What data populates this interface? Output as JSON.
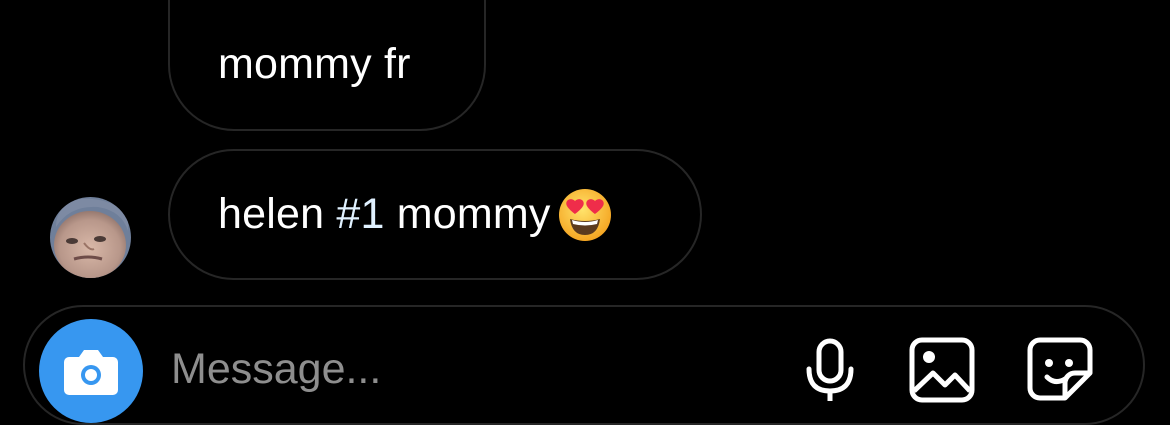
{
  "messages": [
    {
      "text": "mommy fr"
    },
    {
      "text_before": "helen ",
      "hashtag": "#1",
      "text_after": " mommy",
      "emoji": "heart-eyes-emoji"
    }
  ],
  "composer": {
    "placeholder": "Message...",
    "icons": [
      "camera-icon",
      "microphone-icon",
      "gallery-icon",
      "sticker-icon"
    ],
    "accent_color": "#3797f0"
  },
  "colors": {
    "background": "#000000",
    "bubble_border": "#262626",
    "hashtag": "#e0f1ff"
  }
}
